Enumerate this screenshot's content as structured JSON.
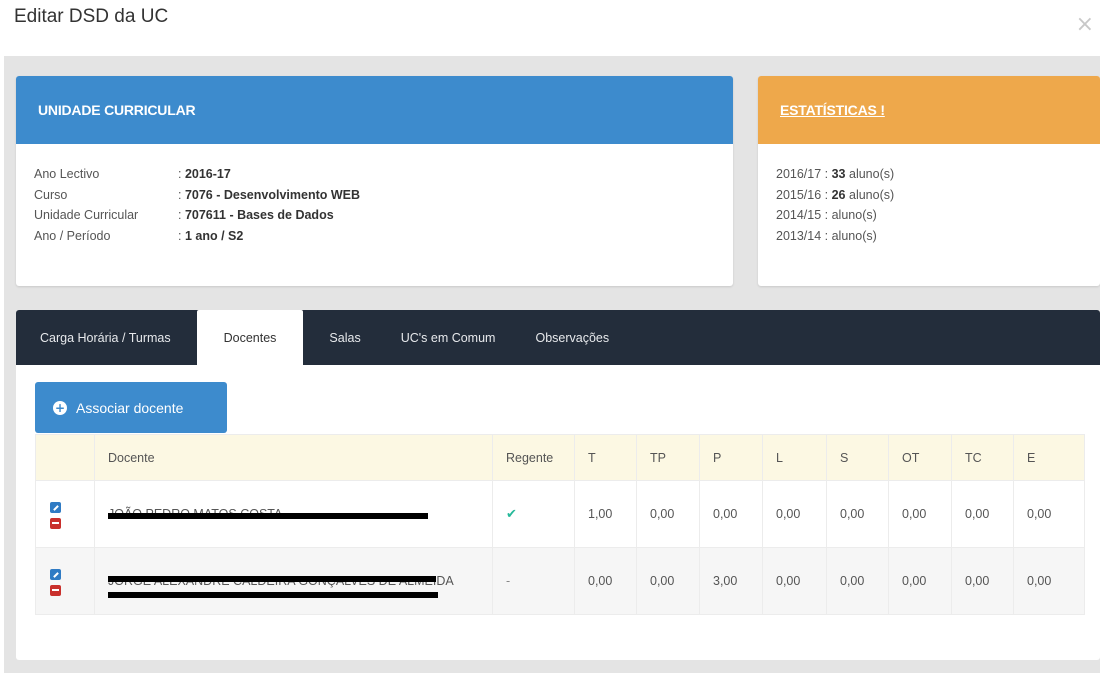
{
  "modal": {
    "title": "Editar DSD da UC",
    "close_label": "×"
  },
  "uc_panel": {
    "header": "UNIDADE CURRICULAR",
    "rows": [
      {
        "label": "Ano Lectivo",
        "value": "2016-17"
      },
      {
        "label": "Curso",
        "value": "7076 - Desenvolvimento WEB"
      },
      {
        "label": "Unidade Curricular",
        "value": "707611 - Bases de Dados"
      },
      {
        "label": "Ano / Período",
        "value": "1 ano / S2"
      }
    ]
  },
  "stats_panel": {
    "header": "ESTATÍSTICAS !",
    "lines": [
      {
        "year": "2016/17",
        "count": "33",
        "suffix": "aluno(s)"
      },
      {
        "year": "2015/16",
        "count": "26",
        "suffix": "aluno(s)"
      },
      {
        "year": "2014/15",
        "count": "",
        "suffix": "aluno(s)"
      },
      {
        "year": "2013/14",
        "count": "",
        "suffix": "aluno(s)"
      }
    ]
  },
  "tabs": [
    {
      "label": "Carga Horária / Turmas",
      "active": false
    },
    {
      "label": "Docentes",
      "active": true
    },
    {
      "label": "Salas",
      "active": false
    },
    {
      "label": "UC's em Comum",
      "active": false
    },
    {
      "label": "Observações",
      "active": false
    }
  ],
  "assoc_button": {
    "label": "Associar docente"
  },
  "table": {
    "headers": [
      "",
      "Docente",
      "Regente",
      "T",
      "TP",
      "P",
      "L",
      "S",
      "OT",
      "TC",
      "E"
    ],
    "rows": [
      {
        "name": "JOÃO PEDRO MATOS COSTA",
        "regente": "✔",
        "values": [
          "1,00",
          "0,00",
          "0,00",
          "0,00",
          "0,00",
          "0,00",
          "0,00",
          "0,00"
        ]
      },
      {
        "name": "JORGE ALEXANDRE CALDEIRA GONÇALVES DE ALMEIDA",
        "regente": "-",
        "values": [
          "0,00",
          "0,00",
          "3,00",
          "0,00",
          "0,00",
          "0,00",
          "0,00",
          "0,00"
        ]
      }
    ]
  },
  "colors": {
    "primary": "#3d8bcd",
    "warning": "#eea84b",
    "tabbar": "#232d3b",
    "table_head": "#fcf8e3",
    "check": "#26b99a",
    "danger": "#c9302c"
  }
}
